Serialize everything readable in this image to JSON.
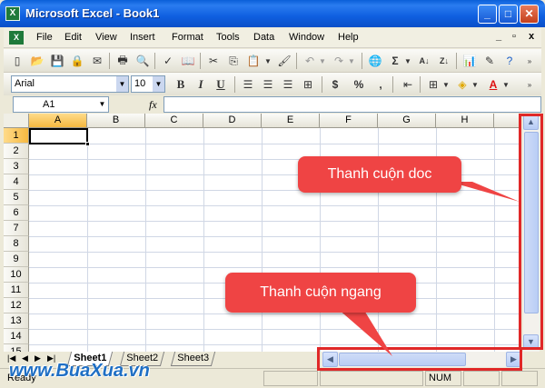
{
  "window": {
    "title": "Microsoft Excel - Book1",
    "minimize": "_",
    "maximize": "□",
    "close": "✕"
  },
  "menu": {
    "items": [
      "File",
      "Edit",
      "View",
      "Insert",
      "Format",
      "Tools",
      "Data",
      "Window",
      "Help"
    ],
    "mdi_min": "_",
    "mdi_restore": "▫",
    "mdi_close": "x"
  },
  "formatting": {
    "font": "Arial",
    "size": "10",
    "bold": "B",
    "italic": "I",
    "underline": "U",
    "currency": "$",
    "percent": "%",
    "comma": ","
  },
  "formula_bar": {
    "name_box": "A1",
    "fx": "fx"
  },
  "grid": {
    "columns": [
      "A",
      "B",
      "C",
      "D",
      "E",
      "F",
      "G",
      "H"
    ],
    "rows": [
      "1",
      "2",
      "3",
      "4",
      "5",
      "6",
      "7",
      "8",
      "9",
      "10",
      "11",
      "12",
      "13",
      "14",
      "15"
    ],
    "active_column": "A",
    "active_row": "1"
  },
  "sheets": {
    "tabs": [
      "Sheet1",
      "Sheet2",
      "Sheet3"
    ],
    "active": "Sheet1"
  },
  "status": {
    "ready": "Ready",
    "num": "NUM"
  },
  "annotations": {
    "vertical_label": "Thanh cuộn doc",
    "horizontal_label": "Thanh cuộn ngang",
    "color": "#ef4444"
  },
  "watermark": "www.BuaXua.vn"
}
